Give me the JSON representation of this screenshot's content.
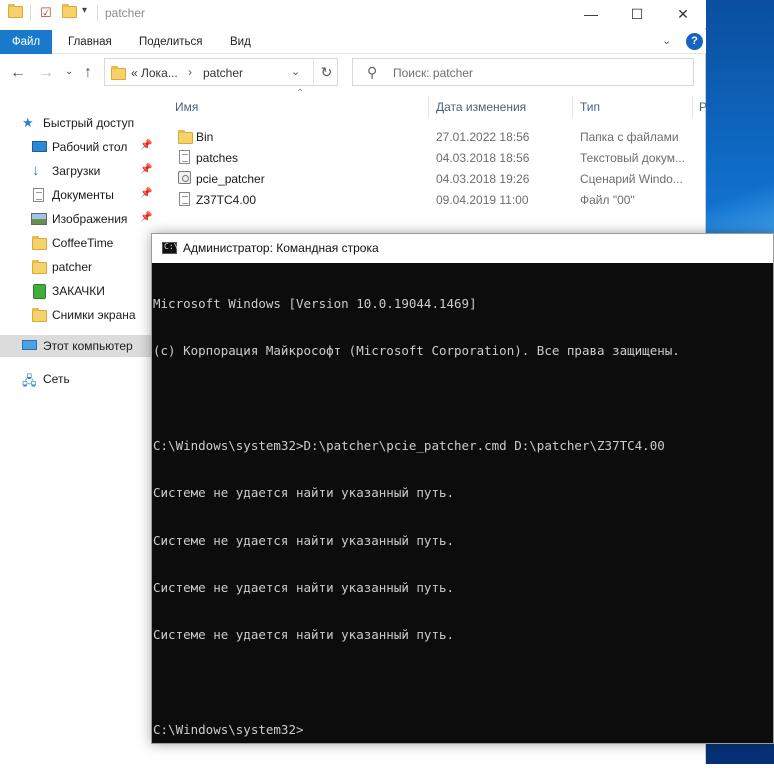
{
  "explorer": {
    "title": "patcher",
    "window_controls": {
      "minimize": "—",
      "maximize": "☐",
      "close": "✕"
    },
    "ribbon_tabs": [
      "Файл",
      "Главная",
      "Поделиться",
      "Вид"
    ],
    "address": {
      "prefix": "« Лока...",
      "current": "patcher"
    },
    "search_placeholder": "Поиск: patcher",
    "columns": [
      "Имя",
      "Дата изменения",
      "Тип",
      "Р"
    ],
    "nav_items": [
      {
        "label": "Быстрый доступ",
        "icon": "star-icon"
      },
      {
        "label": "Рабочий стол",
        "icon": "desktop-icon",
        "pinned": true
      },
      {
        "label": "Загрузки",
        "icon": "download-icon",
        "pinned": true
      },
      {
        "label": "Документы",
        "icon": "documents-icon",
        "pinned": true
      },
      {
        "label": "Изображения",
        "icon": "pictures-icon",
        "pinned": true
      },
      {
        "label": "CoffeeTime",
        "icon": "folder-icon"
      },
      {
        "label": "patcher",
        "icon": "folder-icon"
      },
      {
        "label": "ЗАКАЧКИ",
        "icon": "green-folder-icon"
      },
      {
        "label": "Снимки экрана",
        "icon": "folder-icon"
      },
      {
        "label": "Этот компьютер",
        "icon": "computer-icon",
        "selected": true
      },
      {
        "label": "Сеть",
        "icon": "network-icon"
      }
    ],
    "files": [
      {
        "name": "Bin",
        "date": "27.01.2022 18:56",
        "type": "Папка с файлами",
        "icon": "folder-icon"
      },
      {
        "name": "patches",
        "date": "04.03.2018 18:56",
        "type": "Текстовый докум...",
        "icon": "text-file-icon"
      },
      {
        "name": "pcie_patcher",
        "date": "04.03.2018 19:26",
        "type": "Сценарий Windo...",
        "icon": "script-file-icon"
      },
      {
        "name": "Z37TC4.00",
        "date": "09.04.2019 11:00",
        "type": "Файл \"00\"",
        "icon": "file-icon"
      }
    ]
  },
  "cmd": {
    "title": "Администратор: Командная строка",
    "lines": [
      "Microsoft Windows [Version 10.0.19044.1469]",
      "(c) Корпорация Майкрософт (Microsoft Corporation). Все права защищены.",
      "",
      "C:\\Windows\\system32>D:\\patcher\\pcie_patcher.cmd D:\\patcher\\Z37TC4.00",
      "Системе не удается найти указанный путь.",
      "Системе не удается найти указанный путь.",
      "Системе не удается найти указанный путь.",
      "Системе не удается найти указанный путь.",
      "",
      "C:\\Windows\\system32>"
    ]
  },
  "colors": {
    "accent": "#1979ca",
    "console_bg": "#0c0c0c",
    "console_fg": "#cccccc"
  }
}
